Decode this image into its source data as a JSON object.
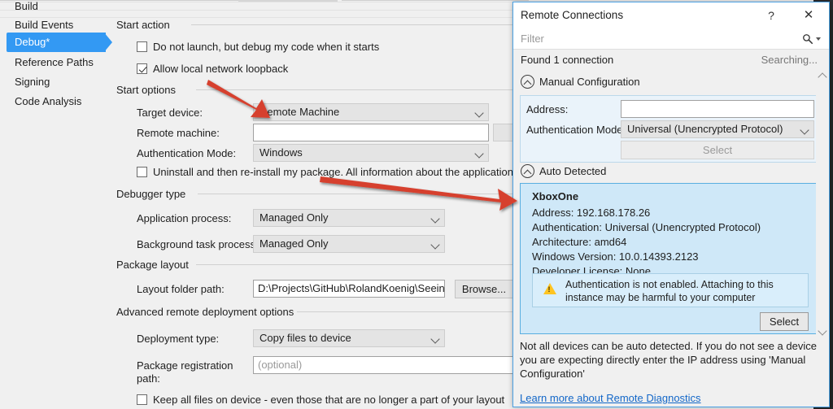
{
  "nav": {
    "items": [
      {
        "label": "Build",
        "selected": false
      },
      {
        "label": "Build Events",
        "selected": false
      },
      {
        "label": "Debug*",
        "selected": true
      },
      {
        "label": "Reference Paths",
        "selected": false
      },
      {
        "label": "Signing",
        "selected": false
      },
      {
        "label": "Code Analysis",
        "selected": false
      }
    ]
  },
  "form": {
    "start_action": {
      "title": "Start action",
      "do_not_launch": {
        "label": "Do not launch, but debug my code when it starts",
        "checked": false
      },
      "loopback": {
        "label": "Allow local network loopback",
        "checked": true
      }
    },
    "start_options": {
      "title": "Start options",
      "target_device": {
        "label": "Target device:",
        "value": "Remote Machine"
      },
      "remote_machine": {
        "label": "Remote machine:",
        "value": ""
      },
      "auth_mode": {
        "label": "Authentication Mode:",
        "value": "Windows"
      },
      "uninstall": {
        "label": "Uninstall and then re-install my package. All information about the application state",
        "checked": false
      }
    },
    "debugger_type": {
      "title": "Debugger type",
      "application_process": {
        "label": "Application process:",
        "value": "Managed Only"
      },
      "background_task_process": {
        "label": "Background task process:",
        "value": "Managed Only"
      }
    },
    "package_layout": {
      "title": "Package layout",
      "layout_folder_path": {
        "label": "Layout folder path:",
        "value": "D:\\Projects\\GitHub\\RolandKoenig\\SeeingSl"
      },
      "browse_label": "Browse..."
    },
    "advanced": {
      "title": "Advanced remote deployment options",
      "deployment_type": {
        "label": "Deployment type:",
        "value": "Copy files to device"
      },
      "package_registration_path": {
        "label": "Package registration path:",
        "placeholder": "(optional)",
        "value": ""
      },
      "keep_files": {
        "label": "Keep all files on device - even those that are no longer a part of your layout",
        "checked": false
      }
    }
  },
  "dialog": {
    "title": "Remote Connections",
    "help_icon": "?",
    "close_icon": "✕",
    "filter": {
      "placeholder": "Filter",
      "value": ""
    },
    "status": {
      "found": "Found 1 connection",
      "searching": "Searching..."
    },
    "manual": {
      "section_title": "Manual Configuration",
      "address": {
        "label": "Address:",
        "value": ""
      },
      "auth_mode": {
        "label": "Authentication Mode:",
        "value": "Universal (Unencrypted Protocol)"
      },
      "select_label": "Select"
    },
    "auto": {
      "section_title": "Auto Detected",
      "device": {
        "name": "XboxOne",
        "details": [
          "Address: 192.168.178.26",
          "Authentication: Universal (Unencrypted Protocol)",
          "Architecture: amd64",
          "Windows Version: 10.0.14393.2123",
          "Developer License: None"
        ],
        "warning": "Authentication is not enabled. Attaching to this instance may be harmful to your computer",
        "select_label": "Select"
      }
    },
    "footer": {
      "text": "Not all devices can be auto detected. If you do not see a device you are expecting directly enter the IP address using 'Manual Configuration'",
      "link": "Learn more about Remote Diagnostics"
    }
  },
  "colors": {
    "accent": "#3399f3",
    "dialog_border": "#4ba1e3",
    "card_bg": "#cfe8f8",
    "annotation": "#d6402f",
    "link": "#1367c8"
  }
}
